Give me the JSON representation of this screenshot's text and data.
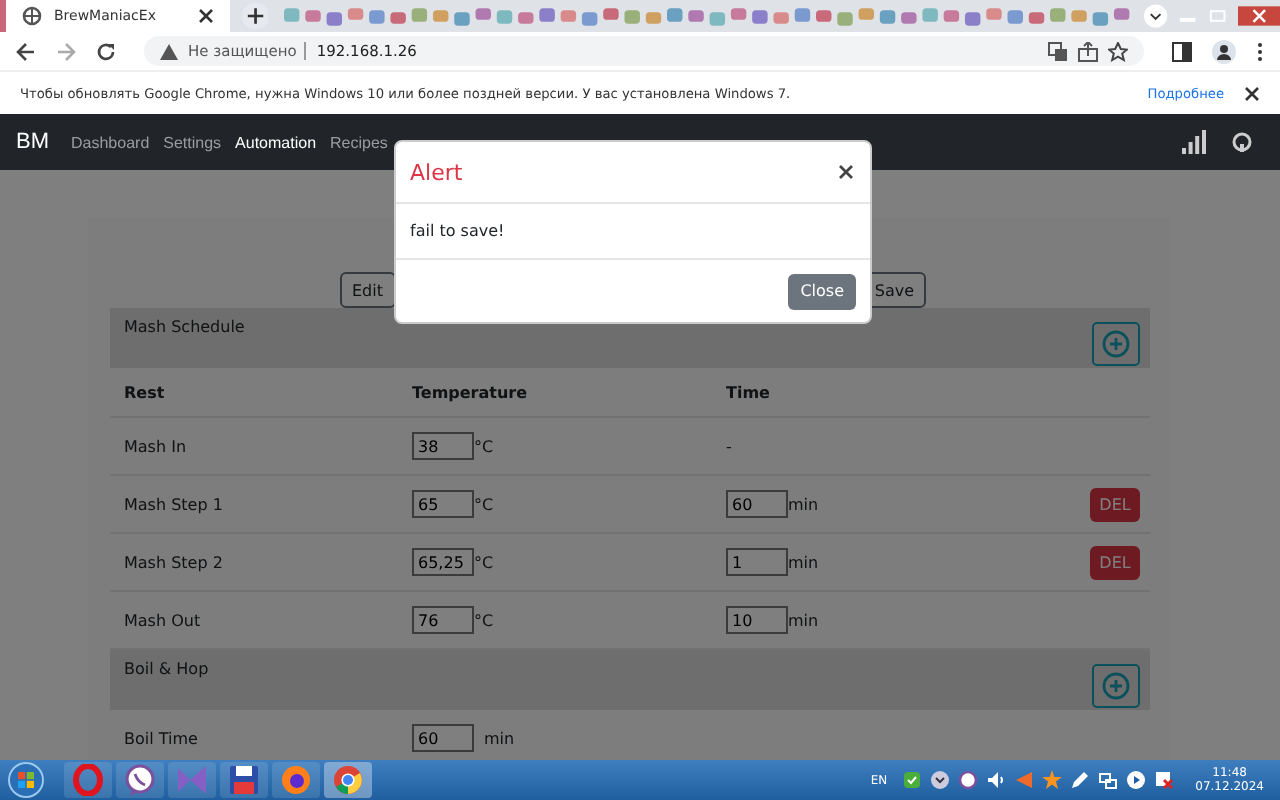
{
  "browser": {
    "tab_title": "BrewManiacEx",
    "security": "Не защищено",
    "url": "192.168.1.26",
    "infobar": {
      "message": "Чтобы обновлять Google Chrome, нужна Windows 10 или более поздней версии. У вас установлена Windows 7.",
      "link": "Подробнее"
    }
  },
  "navbar": {
    "brand": "BM",
    "items": [
      {
        "label": "Dashboard",
        "selected": false
      },
      {
        "label": "Settings",
        "selected": false
      },
      {
        "label": "Automation",
        "selected": true
      },
      {
        "label": "Recipes",
        "selected": false
      }
    ]
  },
  "toolbar": {
    "buttons": [
      "Edit",
      "Save"
    ]
  },
  "mash": {
    "title": "Mash Schedule",
    "columns": [
      "Rest",
      "Temperature",
      "Time"
    ],
    "rows": [
      {
        "name": "Mash In",
        "temp": "38",
        "temp_unit": "°C",
        "time": "-",
        "deletable": false
      },
      {
        "name": "Mash Step 1",
        "temp": "65",
        "temp_unit": "°C",
        "time": "60",
        "time_unit": "min",
        "deletable": true,
        "delete_label": "DEL"
      },
      {
        "name": "Mash Step 2",
        "temp": "65,25",
        "temp_unit": "°C",
        "time": "1",
        "time_unit": "min",
        "deletable": true,
        "delete_label": "DEL"
      },
      {
        "name": "Mash Out",
        "temp": "76",
        "temp_unit": "°C",
        "time": "10",
        "time_unit": "min",
        "deletable": false
      }
    ]
  },
  "boil": {
    "title": "Boil & Hop",
    "rows": [
      {
        "name": "Boil Time",
        "value": "60",
        "unit": "min"
      }
    ]
  },
  "dialog": {
    "title": "Alert",
    "message": "fail to save!",
    "button": "Close"
  },
  "taskbar": {
    "language": "EN",
    "time": "11:48",
    "date": "07.12.2024"
  }
}
